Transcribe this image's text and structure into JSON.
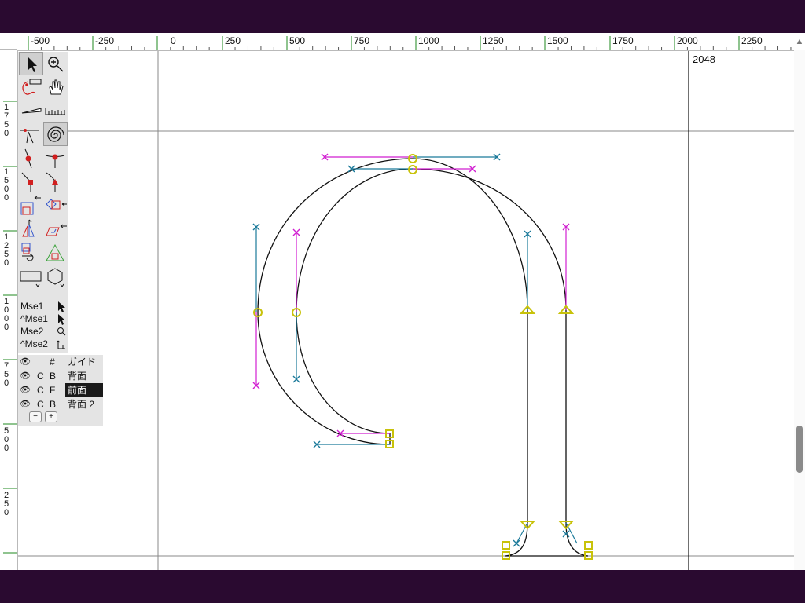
{
  "ruler": {
    "h_labels": [
      "-500",
      "-250",
      "0",
      "250",
      "500",
      "750",
      "1000",
      "1250",
      "1500",
      "1750",
      "2000",
      "2250"
    ],
    "v_groups": [
      [
        "1",
        "7",
        "5",
        "0"
      ],
      [
        "1",
        "5",
        "0",
        "0"
      ],
      [
        "1",
        "2",
        "5",
        "0"
      ],
      [
        "1",
        "0",
        "0",
        "0"
      ],
      [
        "7",
        "5",
        "0"
      ],
      [
        "5",
        "0",
        "0"
      ],
      [
        "2",
        "5",
        "0"
      ]
    ]
  },
  "canvas": {
    "advance_label": "2048"
  },
  "mouse_help": {
    "rows": [
      "Mse1",
      "^Mse1",
      "Mse2",
      "^Mse2"
    ]
  },
  "layers": {
    "header": {
      "col1": "",
      "col2": "#",
      "name": "ガイド"
    },
    "rows": [
      {
        "col1": "C",
        "col2": "B",
        "name": "背面"
      },
      {
        "col1": "C",
        "col2": "F",
        "name": "前面"
      },
      {
        "col1": "C",
        "col2": "B",
        "name": "背面 2"
      }
    ],
    "minus_label": "−",
    "plus_label": "+"
  },
  "colors": {
    "outline": "#111111",
    "guide": "#888888",
    "point": "#c8c20a",
    "cp_next": "#d11fd1",
    "cp_prev": "#1b7a9a",
    "ruler_mark": "#1f8a1f",
    "frame": "#2a0a30"
  }
}
